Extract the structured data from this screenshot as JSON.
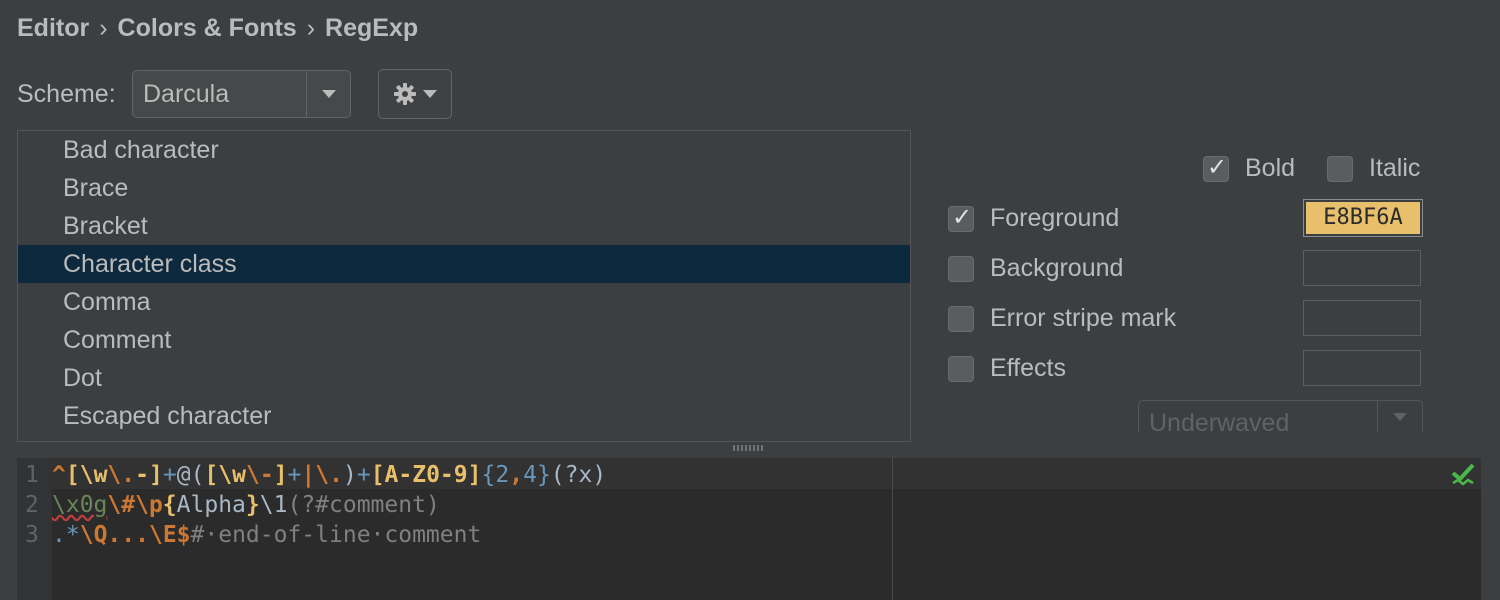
{
  "breadcrumb": {
    "items": [
      "Editor",
      "Colors & Fonts",
      "RegExp"
    ],
    "separator": "›"
  },
  "scheme": {
    "label": "Scheme:",
    "value": "Darcula"
  },
  "list": {
    "items": [
      "Bad character",
      "Brace",
      "Bracket",
      "Character class",
      "Comma",
      "Comment",
      "Dot",
      "Escaped character"
    ],
    "selected_index": 3
  },
  "options": {
    "bold": {
      "label": "Bold",
      "checked": true
    },
    "italic": {
      "label": "Italic",
      "checked": false
    },
    "foreground": {
      "label": "Foreground",
      "checked": true,
      "color": "E8BF6A"
    },
    "background": {
      "label": "Background",
      "checked": false
    },
    "error_stripe": {
      "label": "Error stripe mark",
      "checked": false
    },
    "effects": {
      "label": "Effects",
      "checked": false,
      "type": "Underwaved"
    }
  },
  "preview": {
    "line_numbers": [
      "1",
      "2",
      "3"
    ],
    "lines": [
      [
        {
          "t": "^",
          "c": "#cc7832"
        },
        {
          "t": "[",
          "c": "#e8bf6a"
        },
        {
          "t": "\\w",
          "c": "#e8bf6a"
        },
        {
          "t": "\\.",
          "c": "#cc7832"
        },
        {
          "t": "-",
          "c": "#e8bf6a"
        },
        {
          "t": "]",
          "c": "#e8bf6a"
        },
        {
          "t": "+",
          "c": "#6897bb"
        },
        {
          "t": "@",
          "c": "#a9b7c6"
        },
        {
          "t": "(",
          "c": "#a9b7c6"
        },
        {
          "t": "[",
          "c": "#e8bf6a"
        },
        {
          "t": "\\w",
          "c": "#e8bf6a"
        },
        {
          "t": "\\-",
          "c": "#cc7832"
        },
        {
          "t": "]",
          "c": "#e8bf6a"
        },
        {
          "t": "+",
          "c": "#6897bb"
        },
        {
          "t": "|",
          "c": "#cc7832"
        },
        {
          "t": "\\.",
          "c": "#cc7832"
        },
        {
          "t": ")",
          "c": "#a9b7c6"
        },
        {
          "t": "+",
          "c": "#6897bb"
        },
        {
          "t": "[",
          "c": "#e8bf6a"
        },
        {
          "t": "A-Z0-9",
          "c": "#e8bf6a"
        },
        {
          "t": "]",
          "c": "#e8bf6a"
        },
        {
          "t": "{",
          "c": "#6897bb"
        },
        {
          "t": "2",
          "c": "#6897bb"
        },
        {
          "t": ",",
          "c": "#cc7832"
        },
        {
          "t": "4",
          "c": "#6897bb"
        },
        {
          "t": "}",
          "c": "#6897bb"
        },
        {
          "t": "(?x)",
          "c": "#a9b7c6"
        }
      ],
      [
        {
          "t": "\\x0g",
          "c": "#6a8759",
          "u": true
        },
        {
          "t": "\\#",
          "c": "#cc7832"
        },
        {
          "t": "\\p",
          "c": "#cc7832"
        },
        {
          "t": "{",
          "c": "#e8bf6a"
        },
        {
          "t": "Alpha",
          "c": "#a9b7c6"
        },
        {
          "t": "}",
          "c": "#e8bf6a"
        },
        {
          "t": "\\1",
          "c": "#a9b7c6"
        },
        {
          "t": "(?#comment)",
          "c": "#808080"
        }
      ],
      [
        {
          "t": ".",
          "c": "#6897bb"
        },
        {
          "t": "*",
          "c": "#6897bb"
        },
        {
          "t": "\\Q",
          "c": "#cc7832"
        },
        {
          "t": "...",
          "c": "#cc7832"
        },
        {
          "t": "\\E",
          "c": "#cc7832"
        },
        {
          "t": "$",
          "c": "#cc7832"
        },
        {
          "t": "#·end-of-line·comment",
          "c": "#808080"
        }
      ]
    ]
  },
  "colors": {
    "background": "#3c3f41",
    "selection": "#0d293e",
    "editor_bg": "#2b2b2b",
    "ok_mark": "#4bb84b"
  },
  "icons": [
    "chevron-down-icon",
    "gear-icon",
    "check-icon",
    "inspection-ok-icon",
    "splitter-grip-icon"
  ]
}
